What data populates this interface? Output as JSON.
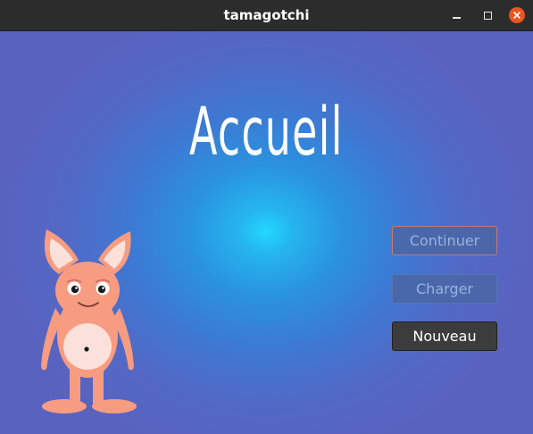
{
  "window": {
    "title": "tamagotchi",
    "controls": [
      "minimize",
      "maximize",
      "close"
    ]
  },
  "screen": {
    "heading": "Accueil"
  },
  "menu": {
    "continue_label": "Continuer",
    "continue_enabled": false,
    "load_label": "Charger",
    "load_enabled": false,
    "new_label": "Nouveau",
    "new_enabled": true
  },
  "colors": {
    "accent_close": "#e95420",
    "background_center": "#22d8ff",
    "background_edge": "#5a62bf",
    "mascot_body": "#f79c80",
    "active_button": "#3c3c3c"
  },
  "icons": [
    "minimize-icon",
    "maximize-icon",
    "close-icon",
    "mascot-illustration"
  ]
}
